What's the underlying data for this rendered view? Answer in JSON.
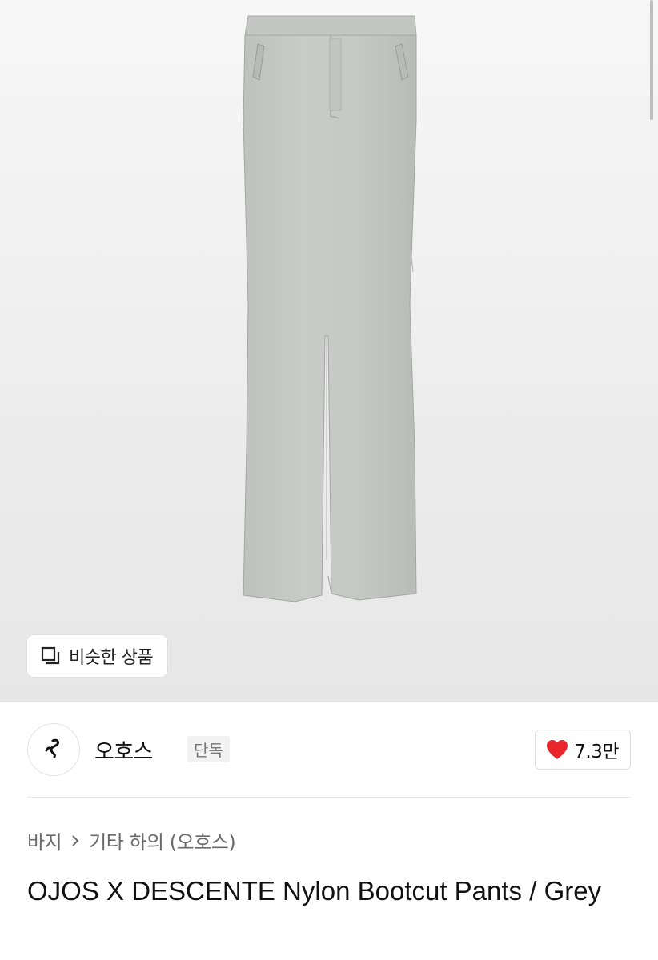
{
  "hero": {
    "similar_button_label": "비슷한 상품",
    "similar_icon": "copy-icon"
  },
  "shop": {
    "name": "오호스",
    "badge": "단독",
    "avatar_icon": "shop-logo-icon",
    "like_count": "7.3만",
    "like_icon": "heart-icon",
    "like_color": "#e8262c"
  },
  "breadcrumb": {
    "items": [
      "바지",
      "기타 하의 (오호스)"
    ],
    "separator_icon": "chevron-right-icon"
  },
  "product": {
    "title": "OJOS X DESCENTE Nylon Bootcut Pants / Grey"
  }
}
